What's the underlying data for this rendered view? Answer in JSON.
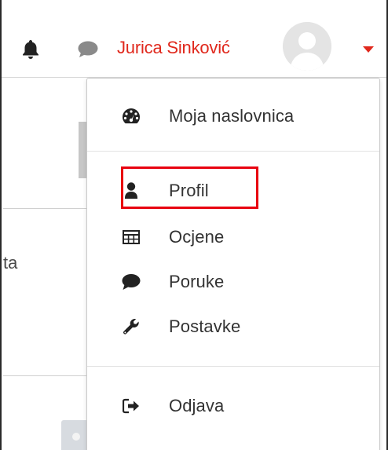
{
  "navbar": {
    "user_name": "Jurica Sinković",
    "icons": {
      "notifications": "bell-icon",
      "messages": "speech-bubble-icon",
      "avatar": "avatar-icon",
      "dropdown": "caret-down-icon"
    },
    "accent_color": "#e0281c"
  },
  "background": {
    "partial_text": "ta"
  },
  "user_menu": {
    "items": [
      {
        "label": "Moja naslovnica",
        "icon": "dashboard-icon"
      },
      {
        "label": "Profil",
        "icon": "user-icon"
      },
      {
        "label": "Ocjene",
        "icon": "table-icon"
      },
      {
        "label": "Poruke",
        "icon": "comment-icon"
      },
      {
        "label": "Postavke",
        "icon": "wrench-icon"
      },
      {
        "label": "Odjava",
        "icon": "sign-out-icon"
      }
    ],
    "highlighted_item": "Profil",
    "highlight_color": "#e8000f"
  }
}
